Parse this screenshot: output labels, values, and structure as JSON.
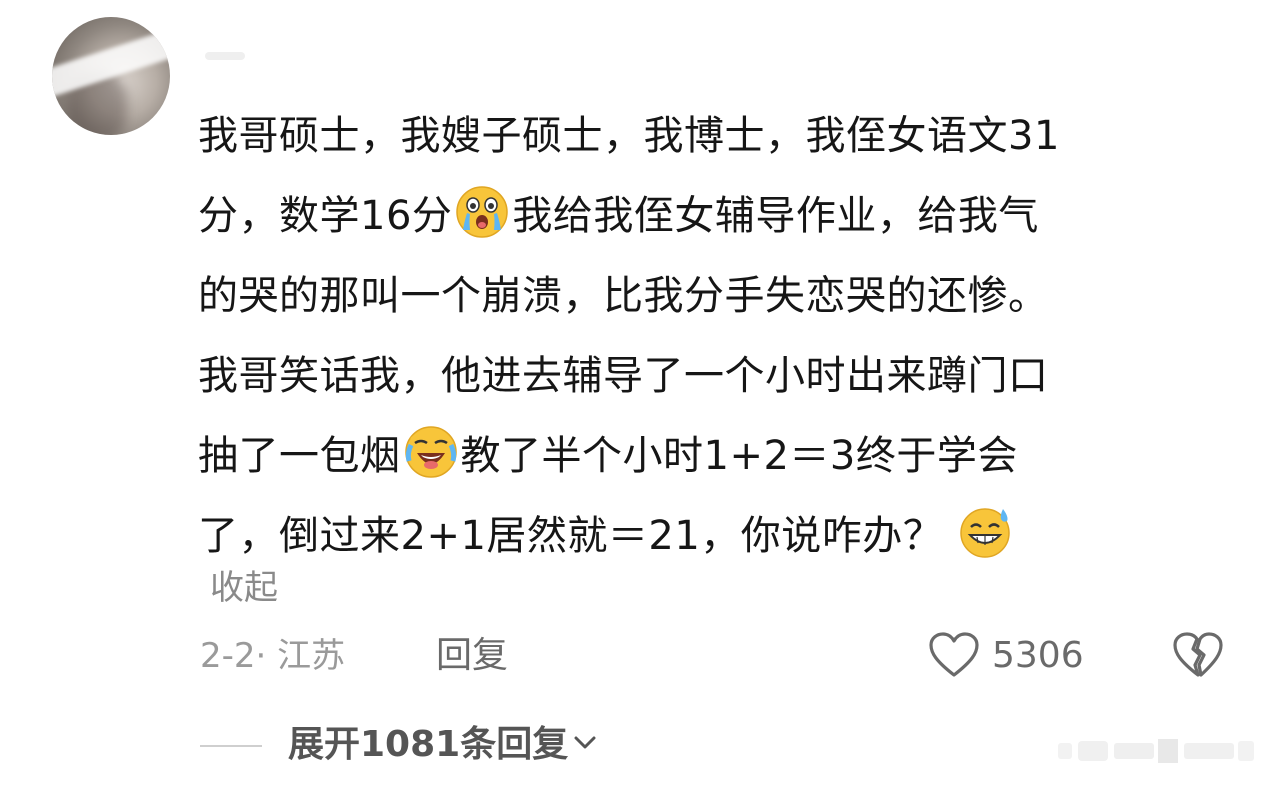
{
  "comment": {
    "lines": [
      {
        "parts": [
          "我哥硕士，我嫂子硕士，我博士，我侄女语文31",
          ""
        ]
      },
      {
        "parts": [
          "分，数学16分",
          "我给我侄女辅导作业，给我气"
        ]
      },
      {
        "parts": [
          "的哭的那叫一个崩溃，比我分手失恋哭的还惨。",
          ""
        ]
      },
      {
        "parts": [
          "我哥笑话我，他进去辅导了一个小时出来蹲门口",
          ""
        ]
      },
      {
        "parts": [
          "抽了一包烟",
          "教了半个小时1+2＝3终于学会"
        ]
      },
      {
        "parts": [
          "了，倒过来2+1居然就＝21，你说咋办？",
          ""
        ]
      }
    ],
    "emojis": [
      "crying-emoji",
      "laughing-crying-emoji",
      "sweat-smile-emoji"
    ]
  },
  "collapse_label": "收起",
  "meta": {
    "date_location": "2-2· 江苏",
    "reply_label": "回复",
    "like_count": "5306"
  },
  "expand_label": "展开1081条回复",
  "colors": {
    "text": "#161616",
    "muted": "#9a9a9a",
    "secondary": "#6a6a6a",
    "emoji_yellow": "#f8c53a"
  }
}
